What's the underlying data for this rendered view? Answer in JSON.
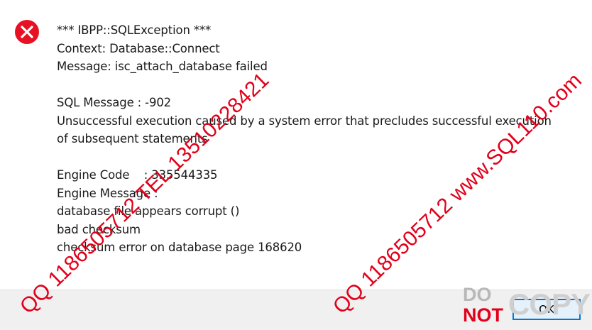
{
  "dialog": {
    "icon": "error-icon",
    "error_color": "#e81123",
    "message_lines": [
      "*** IBPP::SQLException ***",
      "Context: Database::Connect",
      "Message: isc_attach_database failed",
      "",
      "SQL Message : -902",
      "Unsuccessful execution caused by a system error that precludes successful execution",
      "of subsequent statements",
      "",
      "Engine Code    : 335544335",
      "Engine Message :",
      "database file appears corrupt ()",
      "bad checksum",
      "checksum error on database page 168620"
    ],
    "ok_label": "OK"
  },
  "watermarks": {
    "left_text": "QQ 1186505712 TEL 13510228421",
    "right_text": "QQ 1186505712 www.SQL110.com",
    "color": "#e2001a"
  },
  "stamp": {
    "do": "DO",
    "not": "NOT",
    "copy": "COPY"
  }
}
